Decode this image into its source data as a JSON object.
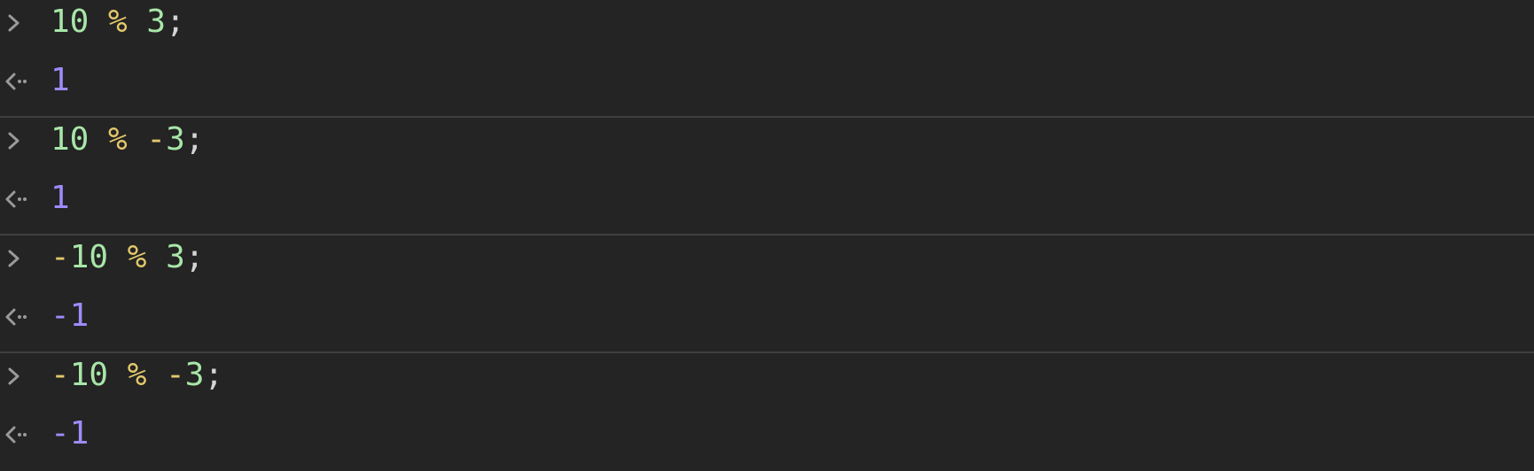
{
  "colors": {
    "background": "#242424",
    "divider": "#3f3f3f",
    "number": "#a8e6a8",
    "operator": "#e3c86b",
    "punctuation": "#d4d4d4",
    "result": "#9e8cff",
    "prompt_icon": "#9a9a9a"
  },
  "icons": {
    "input_prompt": "chevron-right-icon",
    "output_prompt": "return-arrow-icon"
  },
  "entries": [
    {
      "input": {
        "tokens": [
          {
            "t": "num",
            "v": "10"
          },
          {
            "t": "sp",
            "v": " "
          },
          {
            "t": "op",
            "v": "%"
          },
          {
            "t": "sp",
            "v": " "
          },
          {
            "t": "num",
            "v": "3"
          },
          {
            "t": "punct",
            "v": ";"
          }
        ]
      },
      "output": "1"
    },
    {
      "input": {
        "tokens": [
          {
            "t": "num",
            "v": "10"
          },
          {
            "t": "sp",
            "v": " "
          },
          {
            "t": "op",
            "v": "%"
          },
          {
            "t": "sp",
            "v": " "
          },
          {
            "t": "op",
            "v": "-"
          },
          {
            "t": "num",
            "v": "3"
          },
          {
            "t": "punct",
            "v": ";"
          }
        ]
      },
      "output": "1"
    },
    {
      "input": {
        "tokens": [
          {
            "t": "op",
            "v": "-"
          },
          {
            "t": "num",
            "v": "10"
          },
          {
            "t": "sp",
            "v": " "
          },
          {
            "t": "op",
            "v": "%"
          },
          {
            "t": "sp",
            "v": " "
          },
          {
            "t": "num",
            "v": "3"
          },
          {
            "t": "punct",
            "v": ";"
          }
        ]
      },
      "output": "-1"
    },
    {
      "input": {
        "tokens": [
          {
            "t": "op",
            "v": "-"
          },
          {
            "t": "num",
            "v": "10"
          },
          {
            "t": "sp",
            "v": " "
          },
          {
            "t": "op",
            "v": "%"
          },
          {
            "t": "sp",
            "v": " "
          },
          {
            "t": "op",
            "v": "-"
          },
          {
            "t": "num",
            "v": "3"
          },
          {
            "t": "punct",
            "v": ";"
          }
        ]
      },
      "output": "-1"
    }
  ]
}
